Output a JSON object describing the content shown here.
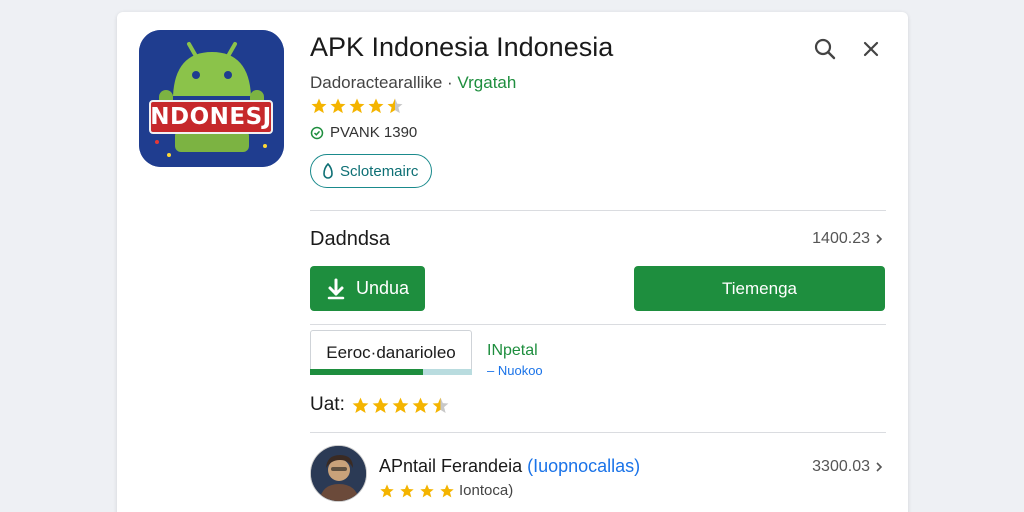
{
  "app": {
    "title": "APK Indonesia Indonesia",
    "subtitle": "Dadoractearallike",
    "developer": "Vrgatah",
    "rating": 4.5,
    "meta_text": "PVANK 1390",
    "chip_label": "Sclotemairc",
    "icon_banner_text": "NDONESJ"
  },
  "section": {
    "label": "Dadndsa",
    "value": "1400.23"
  },
  "buttons": {
    "download_label": "Undua",
    "primary_label": "Tiemenga"
  },
  "tab": {
    "label": "Eeroc·danarioleo",
    "progress": 0.7,
    "side_label": "INpetal",
    "side_sub": "– Nuokoo"
  },
  "rating_row": {
    "label": "Uat:",
    "rating": 4.5
  },
  "list_item": {
    "title": "APntail Ferandeia",
    "category": "(Iuopnocallas)",
    "rating_text": "Iontoca)",
    "stars": 4,
    "value": "3300.03"
  },
  "colors": {
    "accent": "#1e8e3e",
    "star": "#f4b400",
    "link": "#1a73e8"
  },
  "icons": [
    "search-icon",
    "close-icon",
    "check-circle-icon",
    "tag-icon",
    "download-icon",
    "chevron-right-icon",
    "star-icon"
  ]
}
